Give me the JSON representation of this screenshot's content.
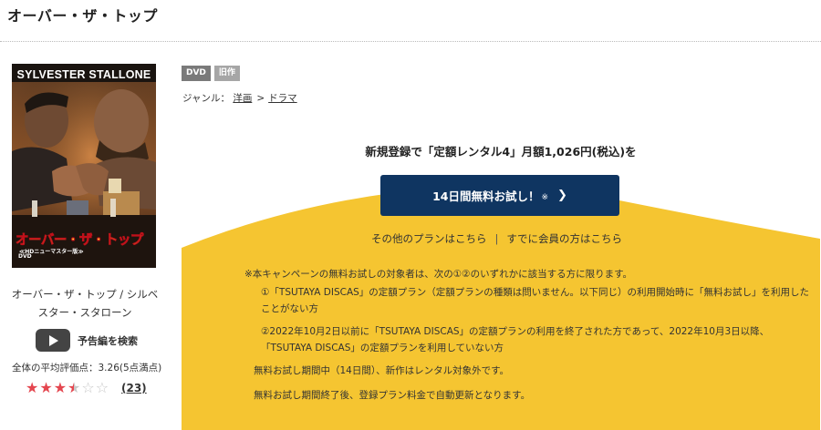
{
  "page": {
    "title": "オーバー・ザ・トップ"
  },
  "jacket": {
    "cast_line": "SYLVESTER STALLONE",
    "title_art": "オーバー・ザ・トップ",
    "subtitle_art": "≪HDニューマスター版≫",
    "dvd_mark": "DVD"
  },
  "work": {
    "name": "オーバー・ザ・トップ / シルベスター・スタローン",
    "trailer_label": "予告編を検索",
    "avg_rating_text": "全体の平均評価点：3.26(5点満点)",
    "stars": [
      "on",
      "on",
      "on",
      "half",
      "off",
      "off"
    ],
    "review_count": "(23)"
  },
  "tags": {
    "dvd": "DVD",
    "old": "旧作"
  },
  "genre": {
    "label": "ジャンル：",
    "items": [
      "洋画",
      "ドラマ"
    ],
    "sep": ">"
  },
  "campaign": {
    "lead": "新規登録で「定額レンタル4」月額1,026円(税込)を",
    "button_label": "14日間無料お試し！",
    "button_note": "※",
    "button_chevron": "❯",
    "link_plans": "その他のプランはこちら",
    "link_separator": "|",
    "link_members": "すでに会員の方はこちら",
    "notice_intro": "※本キャンペーンの無料お試しの対象者は、次の①②のいずれかに該当する方に限ります。",
    "condition_1": "①「TSUTAYA DISCAS」の定額プラン（定額プランの種類は問いません。以下同じ）の利用開始時に「無料お試し」を利用したことがない方",
    "condition_2": "②2022年10月2日以前に「TSUTAYA DISCAS」の定額プランの利用を終了された方であって、2022年10月3日以降、「TSUTAYA DISCAS」の定額プランを利用していない方",
    "note_period": "無料お試し期間中（14日間）、新作はレンタル対象外です。",
    "note_renewal": "無料お試し期間終了後、登録プラン料金で自動更新となります。"
  },
  "colors": {
    "accent_navy": "#0f3561",
    "campaign_yellow": "#f5c531",
    "star_red": "#e4464f"
  }
}
